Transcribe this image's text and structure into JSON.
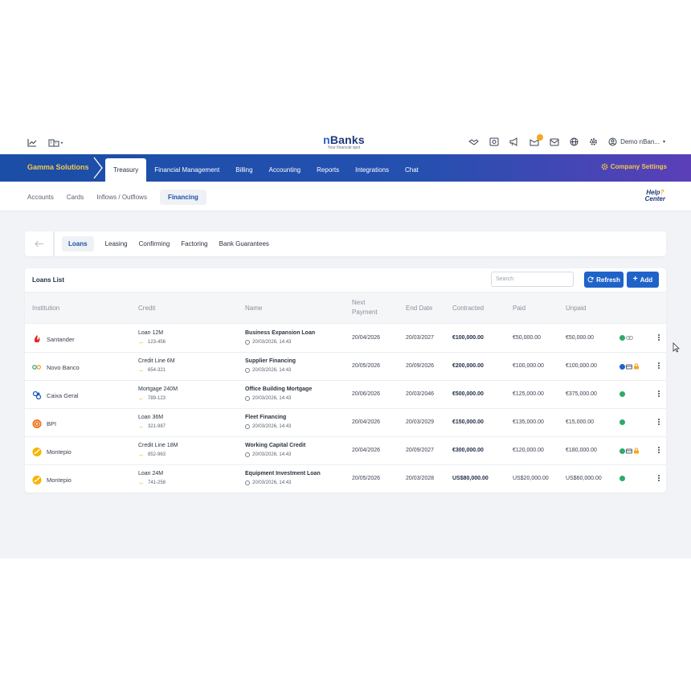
{
  "topbar": {
    "brand": {
      "prefix": "n",
      "name": "Banks",
      "tagline": "Your financial spot"
    },
    "user_label": "Demo nBan...",
    "notification_count": ""
  },
  "mainnav": {
    "company": "Gamma Solutions",
    "tabs": [
      "Treasury",
      "Financial Management",
      "Billing",
      "Accounting",
      "Reports",
      "Integrations",
      "Chat"
    ],
    "active_tab": "Treasury",
    "company_settings": "Company Settings"
  },
  "subnav": {
    "tabs": [
      "Accounts",
      "Cards",
      "Inflows / Outflows",
      "Financing"
    ],
    "active_tab": "Financing",
    "help": {
      "line1": "Help",
      "line2": "Center"
    }
  },
  "financing": {
    "tabs": [
      "Loans",
      "Leasing",
      "Confirming",
      "Factoring",
      "Bank Guarantees"
    ],
    "active_tab": "Loans"
  },
  "loans_list": {
    "title": "Loans List",
    "search_placeholder": "Search",
    "refresh_label": "Refresh",
    "add_label": "Add",
    "columns": {
      "institution": "Institution",
      "credit": "Credit",
      "name": "Name",
      "next_payment_1": "Next",
      "next_payment_2": "Payment",
      "end_date": "End Date",
      "contracted": "Contracted",
      "paid": "Paid",
      "unpaid": "Unpaid"
    },
    "rows": [
      {
        "institution": "Santander",
        "logo": "santander-flame-icon",
        "credit": "Loan 12M",
        "account": "123-456",
        "name": "Business Expansion Loan",
        "created": "20/03/2026, 14:43",
        "next_payment": "20/04/2026",
        "end_date": "20/03/2027",
        "contracted": "€100,000.00",
        "paid": "€50,000.00",
        "unpaid": "€50,000.00",
        "status": [
          "green-dot",
          "link-icon"
        ]
      },
      {
        "institution": "Novo Banco",
        "logo": "novo-banco-icon",
        "credit": "Credit Line 6M",
        "account": "654-321",
        "name": "Supplier Financing",
        "created": "20/03/2026, 14:43",
        "next_payment": "20/05/2026",
        "end_date": "20/09/2026",
        "contracted": "€200,000.00",
        "paid": "€100,000.00",
        "unpaid": "€100,000.00",
        "status": [
          "blue-dot",
          "card-icon",
          "lock-icon"
        ]
      },
      {
        "institution": "Caixa Geral",
        "logo": "caixa-geral-icon",
        "credit": "Mortgage 240M",
        "account": "789-123",
        "name": "Office Building Mortgage",
        "created": "20/03/2026, 14:43",
        "next_payment": "20/06/2026",
        "end_date": "20/03/2046",
        "contracted": "€500,000.00",
        "paid": "€125,000.00",
        "unpaid": "€375,000.00",
        "status": [
          "green-dot"
        ]
      },
      {
        "institution": "BPI",
        "logo": "bpi-icon",
        "credit": "Loan 36M",
        "account": "321-987",
        "name": "Fleet Financing",
        "created": "20/03/2026, 14:43",
        "next_payment": "20/04/2026",
        "end_date": "20/03/2029",
        "contracted": "€150,000.00",
        "paid": "€135,000.00",
        "unpaid": "€15,000.00",
        "status": [
          "green-dot"
        ]
      },
      {
        "institution": "Montepio",
        "logo": "montepio-icon",
        "credit": "Credit Line 18M",
        "account": "852-963",
        "name": "Working Capital Credit",
        "created": "20/03/2026, 14:43",
        "next_payment": "20/04/2026",
        "end_date": "20/09/2027",
        "contracted": "€300,000.00",
        "paid": "€120,000.00",
        "unpaid": "€180,000.00",
        "status": [
          "green-dot",
          "card-icon",
          "lock-icon"
        ]
      },
      {
        "institution": "Montepio",
        "logo": "montepio-icon",
        "credit": "Loan 24M",
        "account": "741-258",
        "name": "Equipment Investment Loan",
        "created": "20/03/2026, 14:43",
        "next_payment": "20/05/2026",
        "end_date": "20/03/2028",
        "contracted": "US$80,000.00",
        "paid": "US$20,000.00",
        "unpaid": "US$60,000.00",
        "status": [
          "green-dot"
        ]
      }
    ]
  },
  "colors": {
    "nav_start": "#1b4ea7",
    "nav_end": "#5b3fb8",
    "accent_gold": "#f5c84c",
    "primary_button": "#1f63c9",
    "status_green": "#2eaa6b",
    "status_blue": "#1f63c9",
    "arrow_orange": "#f5a623"
  }
}
